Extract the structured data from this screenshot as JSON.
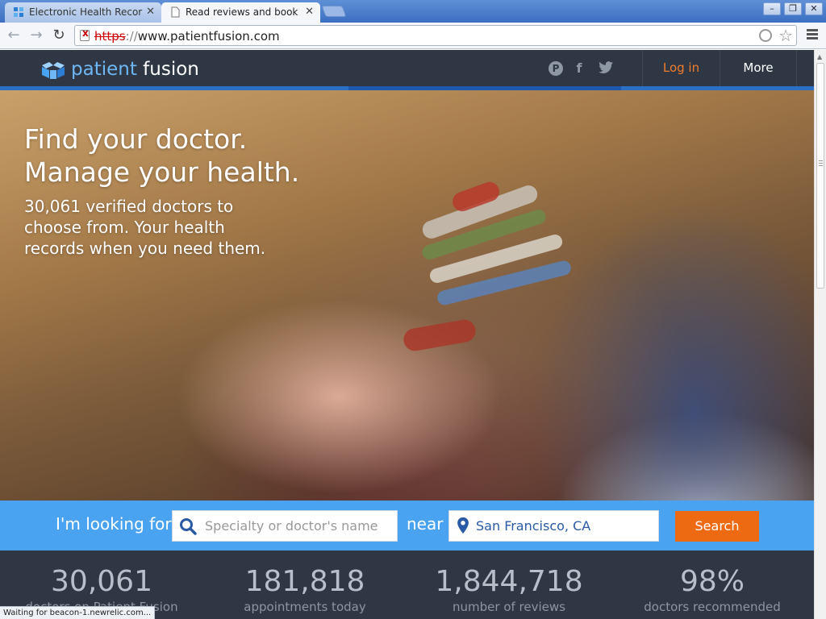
{
  "browser": {
    "tabs": [
      {
        "title": "Electronic Health Recor",
        "active": false
      },
      {
        "title": "Read reviews and book",
        "active": true
      }
    ],
    "url": {
      "scheme": "https",
      "sep": "://",
      "rest": "www.patientfusion.com"
    },
    "status_text": "Waiting for beacon-1.newrelic.com..."
  },
  "header": {
    "logo": {
      "part1": "patient",
      "part2": "fusion"
    },
    "nav": {
      "login": "Log in",
      "more": "More"
    },
    "social": [
      "pinterest-icon",
      "facebook-icon",
      "twitter-icon"
    ]
  },
  "hero": {
    "title_line1": "Find your doctor.",
    "title_line2": "Manage your health.",
    "subtitle": "30,061 verified doctors to choose from. Your health records when you need them."
  },
  "search": {
    "label_looking": "I'm looking for",
    "specialty_placeholder": "Specialty or doctor's name",
    "label_near": "near",
    "location_value": "San Francisco, CA",
    "button": "Search"
  },
  "stats": [
    {
      "number": "30,061",
      "label": "doctors on Patient Fusion"
    },
    {
      "number": "181,818",
      "label": "appointments today"
    },
    {
      "number": "1,844,718",
      "label": "number of reviews"
    },
    {
      "number": "98%",
      "label": "doctors recommended"
    }
  ],
  "colors": {
    "brand_blue": "#4aa3f0",
    "header_dark": "#2f3745",
    "login_orange": "#f07d2c",
    "search_orange": "#ee6a12"
  }
}
